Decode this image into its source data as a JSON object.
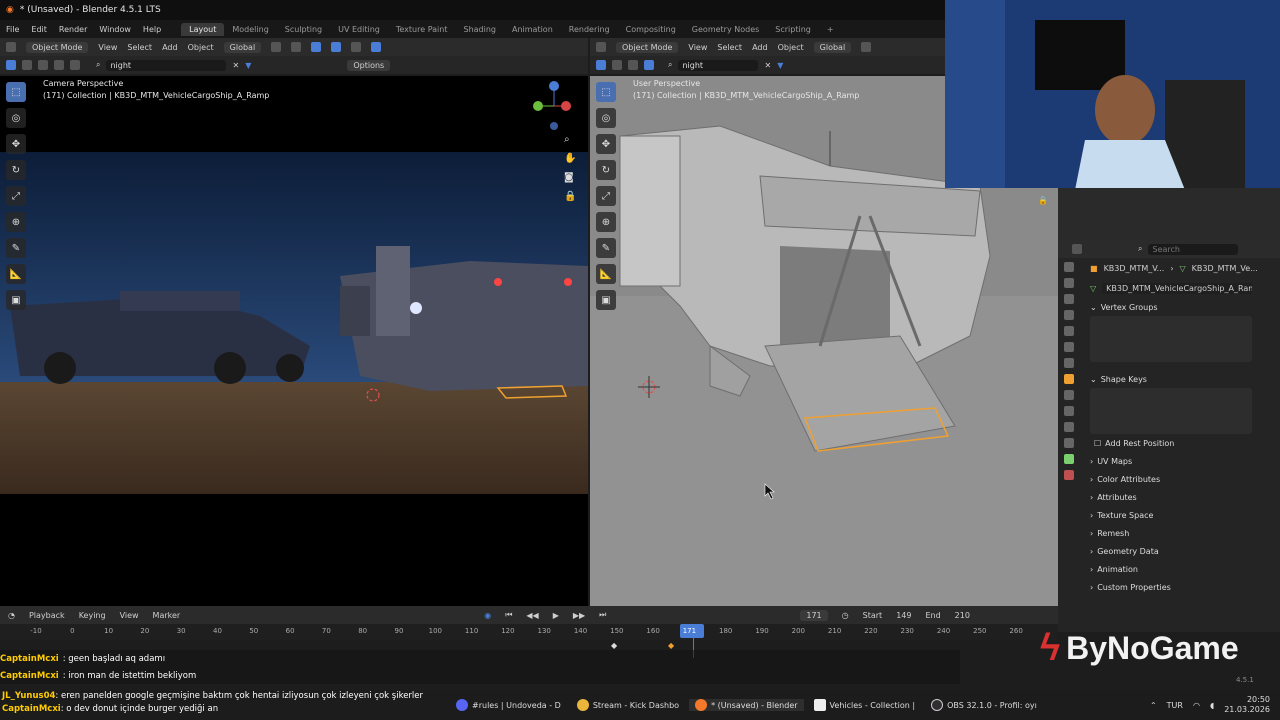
{
  "window": {
    "title": "* (Unsaved) - Blender 4.5.1 LTS"
  },
  "menu": [
    "File",
    "Edit",
    "Render",
    "Window",
    "Help"
  ],
  "workspaces": [
    "Layout",
    "Modeling",
    "Sculpting",
    "UV Editing",
    "Texture Paint",
    "Shading",
    "Animation",
    "Rendering",
    "Compositing",
    "Geometry Nodes",
    "Scripting"
  ],
  "active_workspace": "Layout",
  "left_viewport": {
    "mode": "Object Mode",
    "menus": [
      "View",
      "Select",
      "Add",
      "Object"
    ],
    "orientation": "Global",
    "search": "night",
    "options": "Options",
    "perspective": "Camera Perspective",
    "collection": "(171) Collection | KB3D_MTM_VehicleCargoShip_A_Ramp"
  },
  "right_viewport": {
    "mode": "Object Mode",
    "menus": [
      "View",
      "Select",
      "Add",
      "Object"
    ],
    "orientation": "Global",
    "search": "night",
    "perspective": "User Perspective",
    "collection": "(171) Collection | KB3D_MTM_VehicleCargoShip_A_Ramp"
  },
  "properties": {
    "search_placeholder": "Search",
    "breadcrumb_a": "KB3D_MTM_V...",
    "breadcrumb_b": "KB3D_MTM_Ve...",
    "mesh_name": "KB3D_MTM_VehicleCargoShip_A_Ramp",
    "sections": {
      "vertex_groups": "Vertex Groups",
      "shape_keys": "Shape Keys",
      "add_rest_position": "Add Rest Position",
      "uv_maps": "UV Maps",
      "color_attributes": "Color Attributes",
      "attributes": "Attributes",
      "texture_space": "Texture Space",
      "remesh": "Remesh",
      "geometry_data": "Geometry Data",
      "animation": "Animation",
      "custom_properties": "Custom Properties"
    }
  },
  "timeline": {
    "menus": [
      "Playback",
      "Keying",
      "View",
      "Marker"
    ],
    "current_frame": "171",
    "start_label": "Start",
    "start": "149",
    "end_label": "End",
    "end": "210",
    "ticks": [
      "-10",
      "0",
      "10",
      "20",
      "30",
      "40",
      "50",
      "60",
      "70",
      "80",
      "90",
      "100",
      "110",
      "120",
      "130",
      "140",
      "150",
      "160",
      "171",
      "180",
      "190",
      "200",
      "210",
      "220",
      "230",
      "240",
      "250",
      "260"
    ]
  },
  "chat": [
    {
      "user": "CaptainMcxi",
      "msg": ": geen başladı aq adamı"
    },
    {
      "user": "CaptainMcxi",
      "msg": ": iron man de istettim bekliyom"
    },
    {
      "user": "JL_Yunus04",
      "msg": ": eren panelden google geçmişine baktım çok hentai izliyosun çok izleyeni çok şikerler"
    },
    {
      "user": "CaptainMcxi",
      "msg": ": o dev donut içinde burger yediği an"
    }
  ],
  "taskbar": {
    "apps": [
      "#rules | Undoveda - D",
      "Stream - Kick Dashbo",
      "* (Unsaved) - Blender",
      "Vehicles - Collection |",
      "OBS 32.1.0 - Profil: oyı"
    ],
    "lang": "TUR",
    "time": "20:50",
    "date": "21.03.2026"
  },
  "brand": "ByNoGame",
  "version": "4.5.1",
  "colors": {
    "accent": "#4a7dd6",
    "active_tab": "#3a3a3a",
    "chat_user": "#ffcc00",
    "selection": "#f0a030"
  }
}
